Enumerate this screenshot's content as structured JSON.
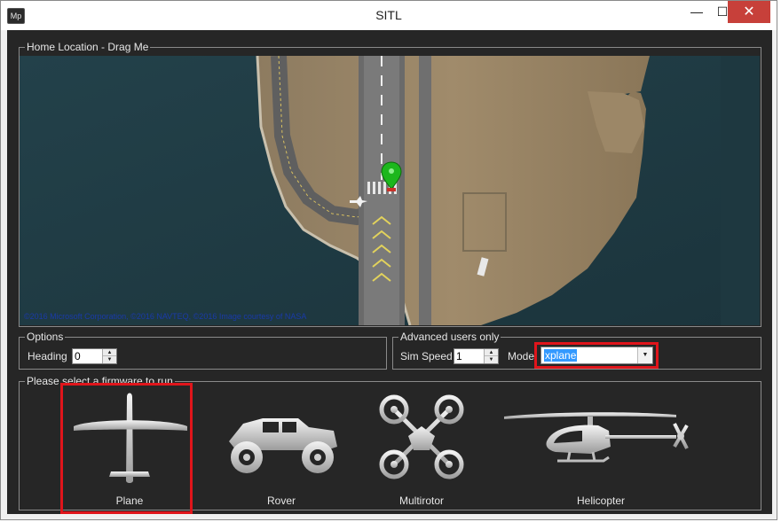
{
  "window": {
    "app_icon_text": "Mp",
    "title": "SITL",
    "minimize_glyph": "—",
    "maximize_glyph": "☐",
    "close_glyph": "✕"
  },
  "home_location": {
    "legend": "Home Location - Drag Me",
    "map_copyright": "©2016 Microsoft Corporation, ©2016 NAVTEQ, ©2016 Image courtesy of NASA",
    "marker_icon": "map-marker-icon"
  },
  "options": {
    "legend": "Options",
    "heading_label": "Heading",
    "heading_value": "0"
  },
  "advanced": {
    "legend": "Advanced users only",
    "sim_speed_label": "Sim Speed",
    "sim_speed_value": "1",
    "model_label": "Model",
    "model_value": "xplane"
  },
  "firmware": {
    "legend": "Please select a firmware to run",
    "items": [
      {
        "label": "Plane",
        "icon": "plane-icon"
      },
      {
        "label": "Rover",
        "icon": "rover-icon"
      },
      {
        "label": "Multirotor",
        "icon": "multirotor-icon"
      },
      {
        "label": "Helicopter",
        "icon": "helicopter-icon"
      }
    ]
  },
  "colors": {
    "client_bg": "#262626",
    "highlight": "#e0151b",
    "close_button": "#c7403a"
  }
}
